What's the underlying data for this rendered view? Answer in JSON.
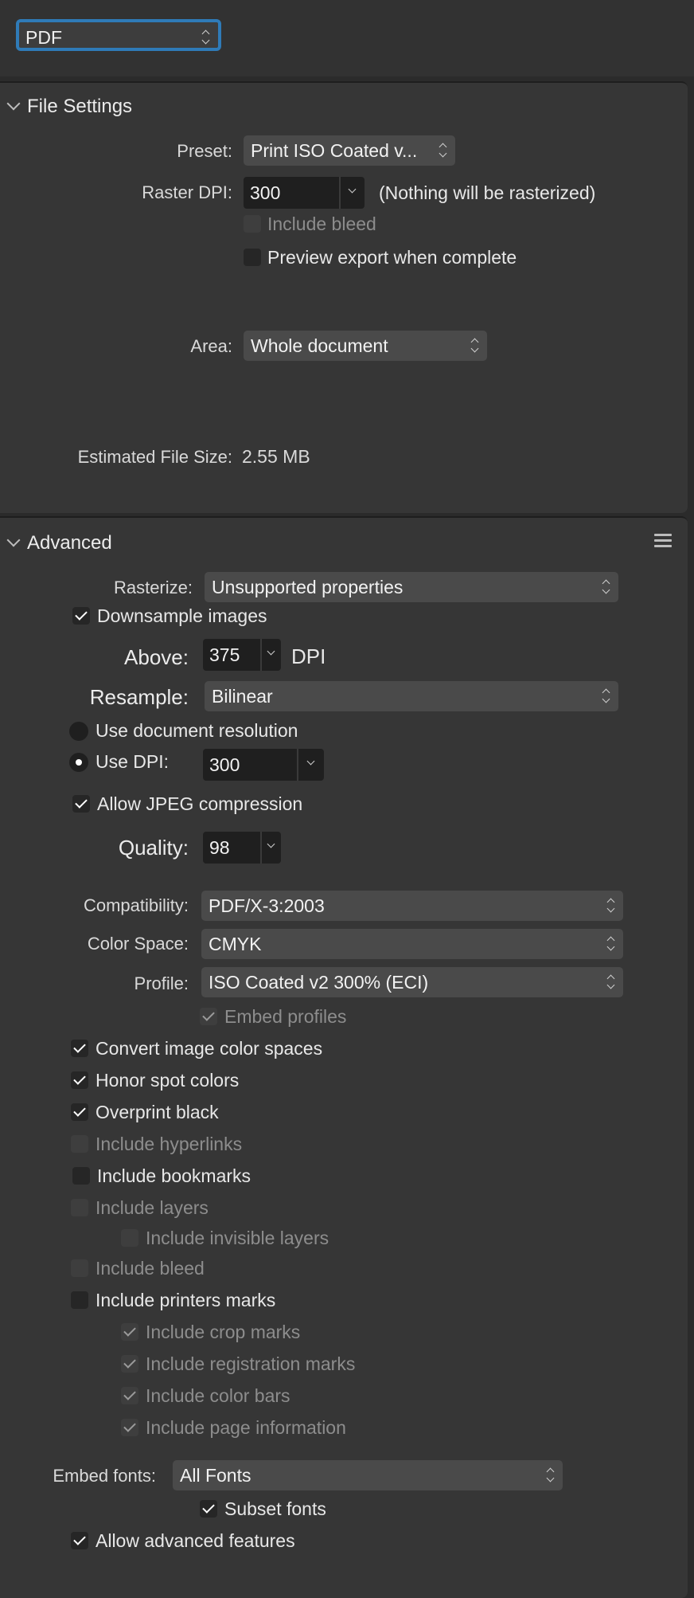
{
  "format": {
    "value": "PDF"
  },
  "file_settings": {
    "title": "File Settings",
    "preset_label": "Preset:",
    "preset_value": "Print ISO Coated v...",
    "raster_dpi_label": "Raster DPI:",
    "raster_dpi_value": "300",
    "raster_note": "(Nothing will be rasterized)",
    "include_bleed": {
      "label": "Include bleed",
      "checked": false,
      "enabled": false
    },
    "preview_export": {
      "label": "Preview export when complete",
      "checked": false,
      "enabled": true
    },
    "area_label": "Area:",
    "area_value": "Whole document",
    "estimated_label": "Estimated File Size:",
    "estimated_value": "2.55 MB"
  },
  "advanced": {
    "title": "Advanced",
    "menu_icon": "hamburger-menu-icon",
    "rasterize_label": "Rasterize:",
    "rasterize_value": "Unsupported properties",
    "downsample": {
      "label": "Downsample images",
      "checked": true
    },
    "above_label": "Above:",
    "above_value": "375",
    "above_unit": "DPI",
    "resample_label": "Resample:",
    "resample_value": "Bilinear",
    "use_doc_res": {
      "label": "Use document resolution",
      "selected": false
    },
    "use_dpi": {
      "label": "Use DPI:",
      "selected": true
    },
    "use_dpi_value": "300",
    "allow_jpeg": {
      "label": "Allow JPEG compression",
      "checked": true
    },
    "quality_label": "Quality:",
    "quality_value": "98",
    "compatibility_label": "Compatibility:",
    "compatibility_value": "PDF/X-3:2003",
    "color_space_label": "Color Space:",
    "color_space_value": "CMYK",
    "profile_label": "Profile:",
    "profile_value": "ISO Coated v2 300% (ECI)",
    "embed_profiles": {
      "label": "Embed profiles",
      "checked": true,
      "enabled": false
    },
    "convert_image_cs": {
      "label": "Convert image color spaces",
      "checked": true
    },
    "honor_spot": {
      "label": "Honor spot colors",
      "checked": true
    },
    "overprint_black": {
      "label": "Overprint black",
      "checked": true
    },
    "include_hyperlinks": {
      "label": "Include hyperlinks",
      "checked": false,
      "enabled": false
    },
    "include_bookmarks": {
      "label": "Include bookmarks",
      "checked": false,
      "enabled": true
    },
    "include_layers": {
      "label": "Include layers",
      "checked": false,
      "enabled": false
    },
    "include_invisible_layers": {
      "label": "Include invisible layers",
      "checked": false,
      "enabled": false
    },
    "include_bleed": {
      "label": "Include bleed",
      "checked": false,
      "enabled": false
    },
    "include_printers_marks": {
      "label": "Include printers marks",
      "checked": false,
      "enabled": true
    },
    "include_crop_marks": {
      "label": "Include crop marks",
      "checked": true,
      "enabled": false
    },
    "include_registration_marks": {
      "label": "Include registration marks",
      "checked": true,
      "enabled": false
    },
    "include_color_bars": {
      "label": "Include color bars",
      "checked": true,
      "enabled": false
    },
    "include_page_info": {
      "label": "Include page information",
      "checked": true,
      "enabled": false
    },
    "embed_fonts_label": "Embed  fonts:",
    "embed_fonts_value": "All Fonts",
    "subset_fonts": {
      "label": "Subset fonts",
      "checked": true
    },
    "allow_advanced": {
      "label": "Allow advanced features",
      "checked": true
    }
  },
  "colors": {
    "accent": "#2f7bb8",
    "panel": "#363636",
    "background": "#2b2b2b"
  }
}
